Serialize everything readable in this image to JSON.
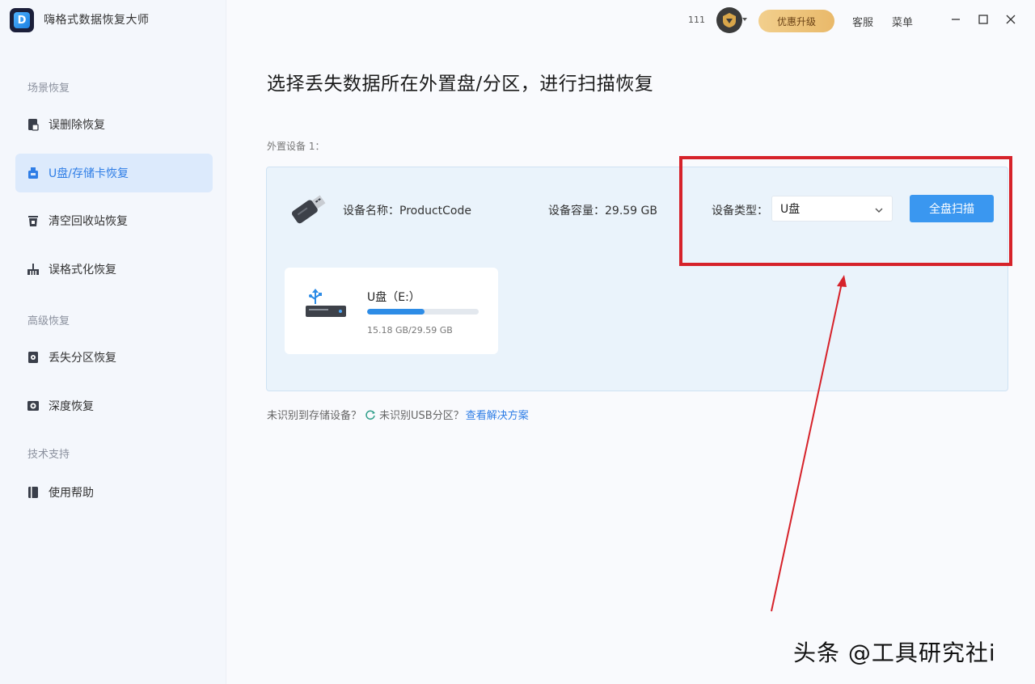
{
  "app": {
    "title": "嗨格式数据恢复大师",
    "logo_letter": "D"
  },
  "topbar": {
    "count": "111",
    "upgrade_label": "优惠升级",
    "service_label": "客服",
    "menu_label": "菜单"
  },
  "sidebar": {
    "sections": [
      {
        "label": "场景恢复"
      },
      {
        "label": "高级恢复"
      },
      {
        "label": "技术支持"
      }
    ],
    "items": [
      {
        "label": "误删除恢复",
        "icon": "document-icon",
        "active": false
      },
      {
        "label": "U盘/存储卡恢复",
        "icon": "usb-drive-icon",
        "active": true
      },
      {
        "label": "清空回收站恢复",
        "icon": "trash-icon",
        "active": false
      },
      {
        "label": "误格式化恢复",
        "icon": "broom-icon",
        "active": false
      },
      {
        "label": "丢失分区恢复",
        "icon": "partition-icon",
        "active": false
      },
      {
        "label": "深度恢复",
        "icon": "deep-scan-icon",
        "active": false
      },
      {
        "label": "使用帮助",
        "icon": "help-book-icon",
        "active": false
      }
    ]
  },
  "main": {
    "title": "选择丢失数据所在外置盘/分区，进行扫描恢复",
    "external_label": "外置设备 1：",
    "device": {
      "name_label": "设备名称：",
      "name_value": "ProductCode",
      "capacity_label": "设备容量：",
      "capacity_value": "29.59 GB",
      "type_label": "设备类型：",
      "type_value": "U盘",
      "scan_label": "全盘扫描"
    },
    "partition": {
      "name": "U盘（E:）",
      "used_fraction": 0.513,
      "size_text": "15.18 GB/29.59 GB"
    },
    "hint": {
      "text1": "未识别到存储设备？",
      "text2": "未识别USB分区？",
      "link": "查看解决方案"
    }
  },
  "colors": {
    "accent": "#3a97f0",
    "highlight_box": "#d6222a",
    "upgrade": "#e9b96a"
  },
  "watermark": "头条 @工具研究社i"
}
